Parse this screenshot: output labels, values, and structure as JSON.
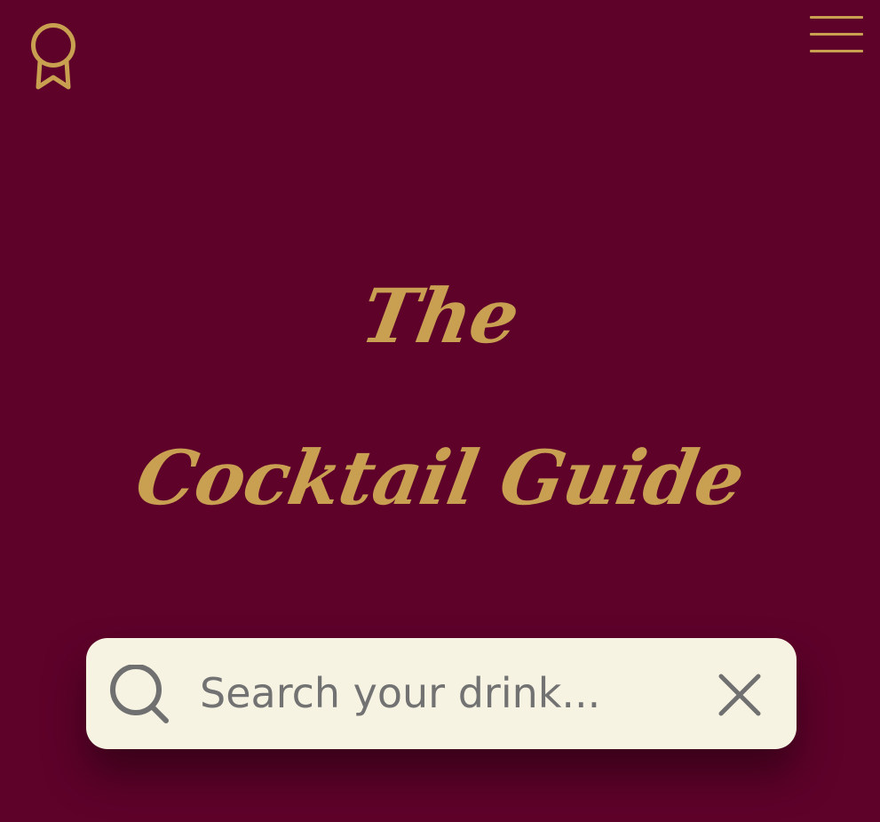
{
  "header": {
    "logo_icon": "award-ribbon-icon",
    "menu_icon": "hamburger-menu-icon"
  },
  "hero": {
    "title_line1": "The",
    "title_line2": "Cocktail Guide"
  },
  "search": {
    "placeholder": "Search your drink...",
    "value": "",
    "search_icon": "search-icon",
    "clear_icon": "close-icon"
  },
  "colors": {
    "background": "#5e022a",
    "accent_gold": "#c9a052",
    "search_bg": "#f6f3e3",
    "search_text": "#727272"
  }
}
